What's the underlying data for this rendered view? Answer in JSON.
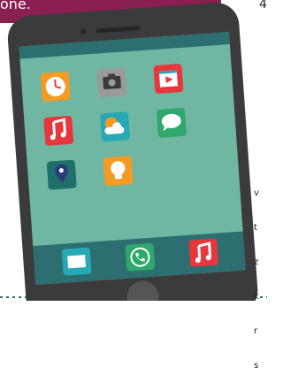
{
  "callout": {
    "text": "one.",
    "color": "#8a1f52"
  },
  "side_text_lines": [
    "v",
    "t",
    "z",
    "k",
    "r",
    "s"
  ],
  "corner_mark": "4",
  "phone": {
    "body_color": "#3b3b3b",
    "screen_color": "#6fb7a3",
    "status_bar_color": "#2d6e70",
    "dock_color": "#2d6e70",
    "home_button_color": "#555555"
  },
  "apps": [
    {
      "icon": "clock-icon",
      "color": "#f59a22"
    },
    {
      "icon": "camera-icon",
      "color": "#9a9a9a"
    },
    {
      "icon": "video-player-icon",
      "color": "#e8373c"
    },
    {
      "icon": "music-icon",
      "color": "#e8373c"
    },
    {
      "icon": "weather-icon",
      "color": "#27a9b5"
    },
    {
      "icon": "messages-icon",
      "color": "#2fa86b"
    },
    {
      "icon": "maps-icon",
      "color": "#1f6f6a"
    },
    {
      "icon": "lightbulb-icon",
      "color": "#f59a22"
    }
  ],
  "dock": [
    {
      "icon": "mail-icon",
      "color": "#27a9b5"
    },
    {
      "icon": "phone-icon",
      "color": "#2fa86b"
    },
    {
      "icon": "music-icon",
      "color": "#e8373c"
    }
  ]
}
